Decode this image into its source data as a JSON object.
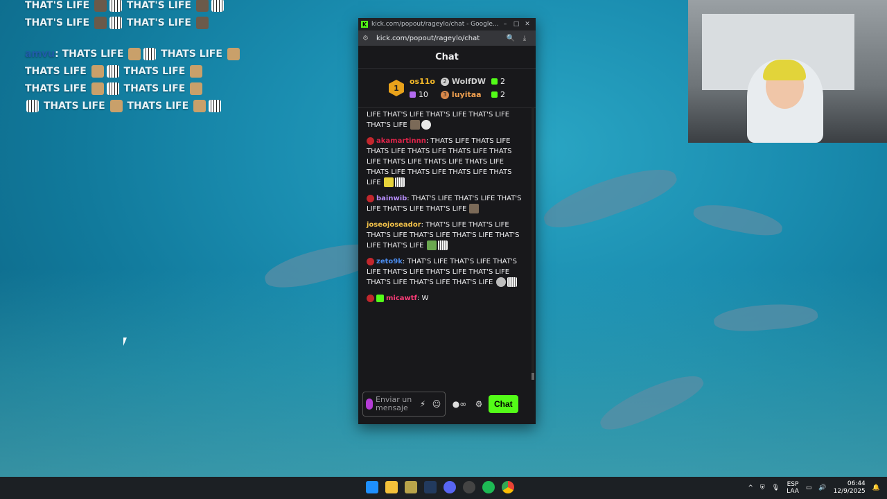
{
  "overlay": {
    "line1": "THAT'S LIFE",
    "line2": "THAT'S LIFE",
    "line3": "THAT'S LIFE",
    "line4": "THAT'S LIFE",
    "user": "amvu",
    "msg_word": "THATS LIFE"
  },
  "window": {
    "title": "kick.com/popout/rageylo/chat - Google...",
    "url": "kick.com/popout/rageylo/chat",
    "logo": "K"
  },
  "chat": {
    "header": "Chat",
    "leaderboard": {
      "first": {
        "rank": "1",
        "name": "os11o",
        "count": "10"
      },
      "second": {
        "rank": "2",
        "name": "WolfDW",
        "count": "2"
      },
      "third": {
        "rank": "3",
        "name": "luyitaa",
        "count": "2"
      }
    },
    "messages": [
      {
        "user": "",
        "text": "LIFE THAT'S LIFE THAT'S LIFE THAT'S LIFE THAT'S LIFE"
      },
      {
        "user": "akamartinnn",
        "text": "THATS LIFE THATS LIFE THATS LIFE THATS LIFE THATS LIFE THATS LIFE THATS LIFE THATS LIFE THATS LIFE THATS LIFE THATS LIFE THATS LIFE THATS LIFE"
      },
      {
        "user": "bainwib",
        "text": "THAT'S LIFE THAT'S LIFE THAT'S LIFE THAT'S LIFE THAT'S LIFE"
      },
      {
        "user": "joseojoseador",
        "text": "THAT'S LIFE THAT'S LIFE THAT'S LIFE THAT'S LIFE THAT'S LIFE THAT'S LIFE THAT'S LIFE"
      },
      {
        "user": "zeto9k",
        "text": "THAT'S LIFE THAT'S LIFE THAT'S LIFE THAT'S LIFE THAT'S LIFE THAT'S LIFE THAT'S LIFE THAT'S LIFE THAT'S LIFE"
      },
      {
        "user": "micawtf",
        "text": "W"
      }
    ],
    "input_placeholder": "Enviar un mensaje",
    "send_label": "Chat"
  },
  "tray": {
    "lang_top": "ESP",
    "lang_bottom": "LAA",
    "time": "06:44",
    "date": "12/9/2025"
  },
  "colors": {
    "kick_green": "#53fc18",
    "chat_bg": "#18181b"
  }
}
